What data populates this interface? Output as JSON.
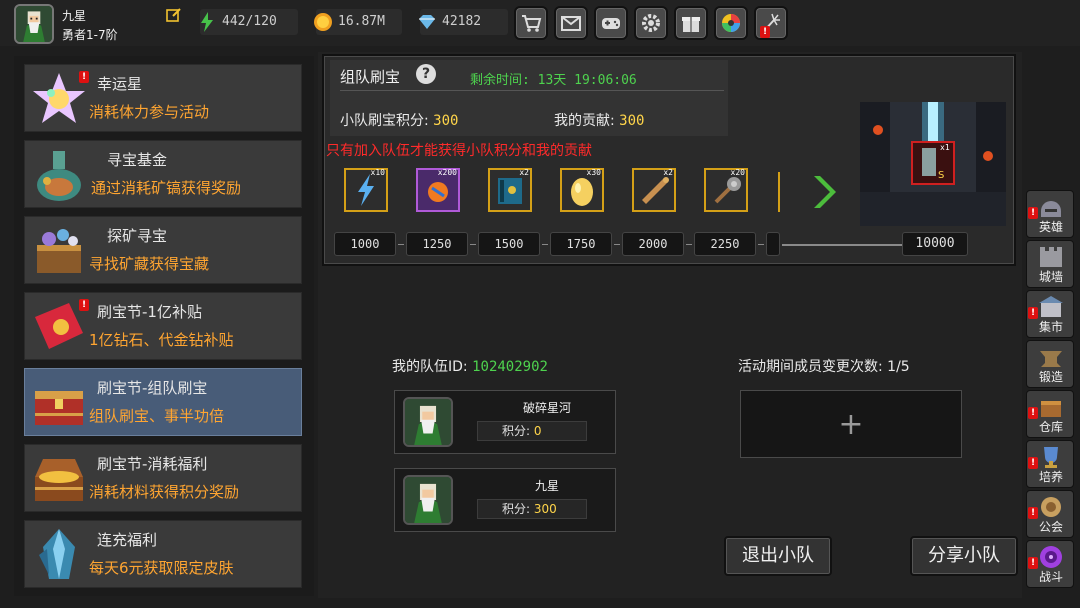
{
  "player": {
    "name": "九星",
    "rank": "勇者1-7阶"
  },
  "resources": {
    "stamina": "442/120",
    "gold": "16.87M",
    "diamonds": "42182"
  },
  "toolbar": [
    "shop-icon",
    "mail-icon",
    "gamepad-icon",
    "settings-icon",
    "gift-icon",
    "camera-icon",
    "fireworks-icon"
  ],
  "sidebar": {
    "items": [
      {
        "title": "幸运星",
        "subtitle": "消耗体力参与活动",
        "badge": "!"
      },
      {
        "title": "寻宝基金",
        "subtitle": "通过消耗矿镐获得奖励"
      },
      {
        "title": "探矿寻宝",
        "subtitle": "寻找矿藏获得宝藏"
      },
      {
        "title": "刷宝节-1亿补贴",
        "subtitle": "1亿钻石、代金钻补贴",
        "badge": "!"
      },
      {
        "title": "刷宝节-组队刷宝",
        "subtitle": "组队刷宝、事半功倍",
        "selected": true
      },
      {
        "title": "刷宝节-消耗福利",
        "subtitle": "消耗材料获得积分奖励"
      },
      {
        "title": "连充福利",
        "subtitle": "每天6元获取限定皮肤"
      }
    ]
  },
  "event": {
    "title": "组队刷宝",
    "time_label": "剩余时间: 13天 19:06:06",
    "team_score_label": "小队刷宝积分:",
    "team_score": "300",
    "my_contrib_label": "我的贡献:",
    "my_contrib": "300",
    "warning": "只有加入队伍才能获得小队积分和我的贡献",
    "rewards": [
      {
        "icon": "lightning-icon",
        "count": "x10"
      },
      {
        "icon": "fire-orb-icon",
        "count": "x200"
      },
      {
        "icon": "spellbook-icon",
        "count": "x2"
      },
      {
        "icon": "golden-egg-icon",
        "count": "x30"
      },
      {
        "icon": "scroll-icon",
        "count": "x2"
      },
      {
        "icon": "mace-icon",
        "count": "x20"
      }
    ],
    "milestones": [
      "1000",
      "1250",
      "1500",
      "1750",
      "2000",
      "2250",
      "",
      "10000"
    ],
    "grand_prize_count": "x1",
    "grand_prize_grade": "S"
  },
  "team": {
    "id_label": "我的队伍ID:",
    "id": "102402902",
    "changes_label": "活动期间成员变更次数: 1/5",
    "members": [
      {
        "name": "破碎星河",
        "score_label": "积分:",
        "score": "0"
      },
      {
        "name": "九星",
        "score_label": "积分:",
        "score": "300"
      }
    ],
    "add_symbol": "+",
    "leave_button": "退出小队",
    "share_button": "分享小队"
  },
  "right_menu": [
    {
      "label": "英雄",
      "icon": "helmet-icon",
      "badge": "!"
    },
    {
      "label": "城墙",
      "icon": "wall-icon"
    },
    {
      "label": "集市",
      "icon": "market-icon",
      "badge": "!"
    },
    {
      "label": "锻造",
      "icon": "anvil-icon"
    },
    {
      "label": "仓库",
      "icon": "warehouse-icon",
      "badge": "!"
    },
    {
      "label": "培养",
      "icon": "trophy-icon",
      "badge": "!"
    },
    {
      "label": "公会",
      "icon": "guild-icon",
      "badge": "!"
    },
    {
      "label": "战斗",
      "icon": "portal-icon",
      "badge": "!"
    }
  ],
  "colors": {
    "accent_orange": "#ffa531",
    "score_yellow": "#ffd54a",
    "green": "#4ed24e",
    "warning_red": "#ff2a2a",
    "selected_card": "#485c78"
  }
}
